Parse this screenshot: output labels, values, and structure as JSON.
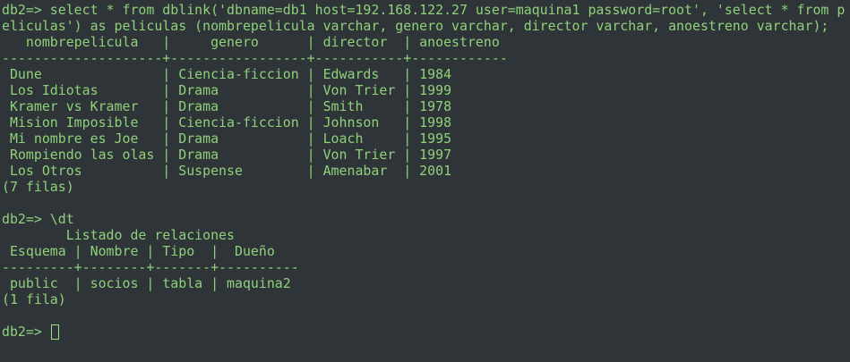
{
  "terminal": {
    "colors": {
      "background": "#2f3438",
      "text": "#8fd17b",
      "cursor": "#9ee088"
    },
    "lines": [
      "db2=> select * from dblink('dbname=db1 host=192.168.122.27 user=maquina1 password=root', 'select * from p",
      "eliculas') as peliculas (nombrepelicula varchar, genero varchar, director varchar, anoestreno varchar);",
      "   nombrepelicula   |     genero      | director  | anoestreno",
      "--------------------+-----------------+-----------+------------",
      " Dune               | Ciencia-ficcion | Edwards   | 1984",
      " Los Idiotas        | Drama           | Von Trier | 1999",
      " Kramer vs Kramer   | Drama           | Smith     | 1978",
      " Mision Imposible   | Ciencia-ficcion | Johnson   | 1998",
      " Mi nombre es Joe   | Drama           | Loach     | 1995",
      " Rompiendo las olas | Drama           | Von Trier | 1997",
      " Los Otros          | Suspense        | Amenabar  | 2001",
      "(7 filas)",
      "",
      "db2=> \\dt",
      "        Listado de relaciones",
      " Esquema | Nombre | Tipo  |  Dueño",
      "---------+--------+-------+----------",
      " public  | socios | tabla | maquina2",
      "(1 fila)",
      "",
      "db2=> "
    ]
  }
}
